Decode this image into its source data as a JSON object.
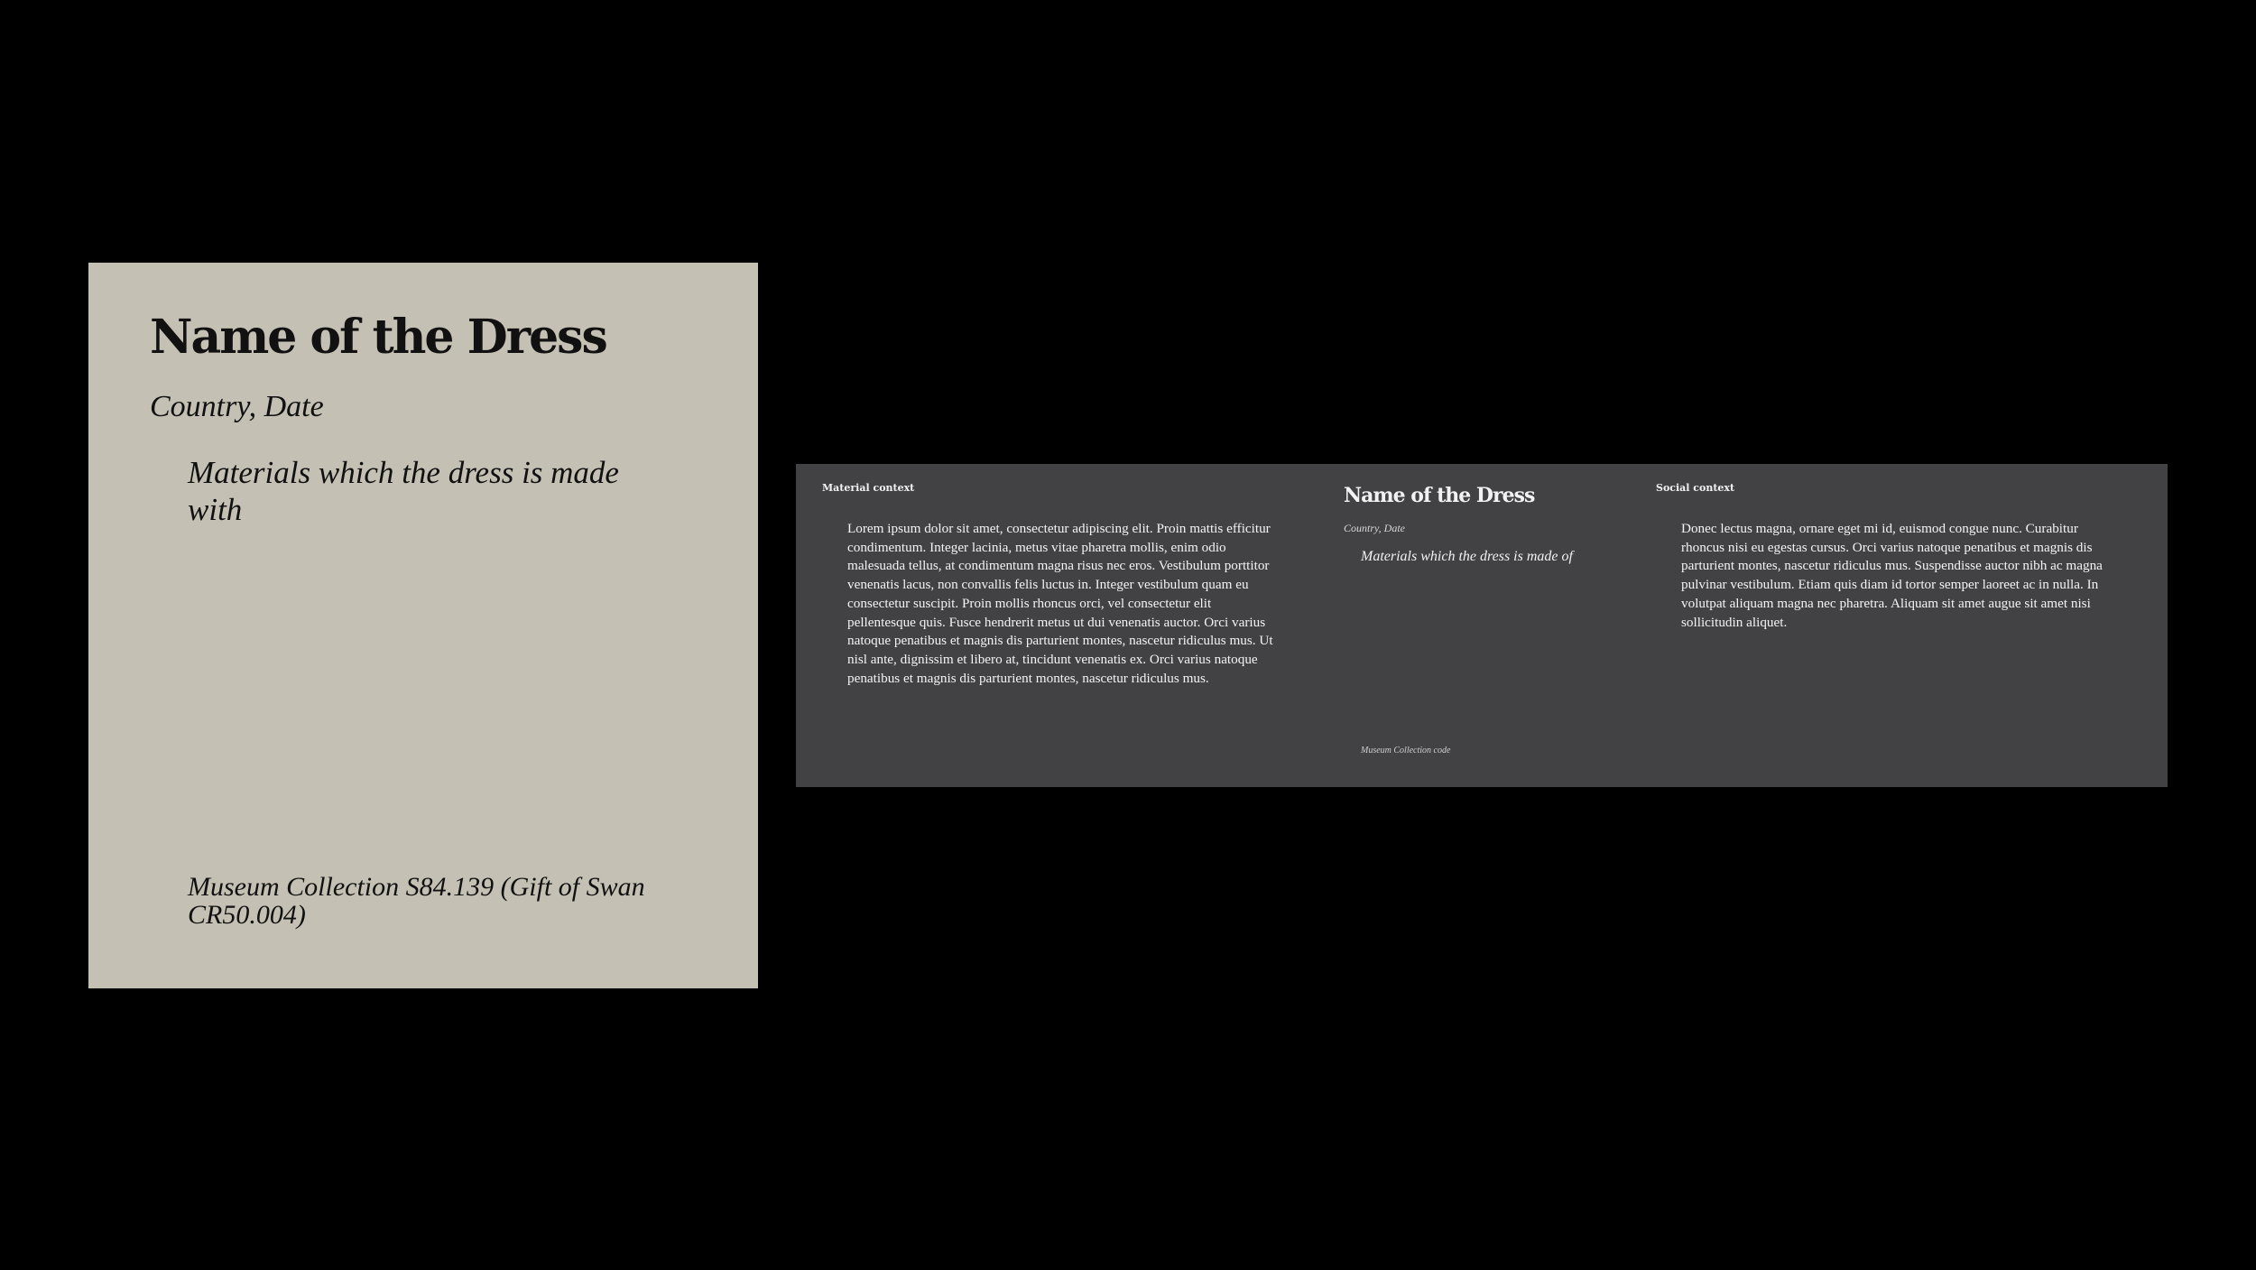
{
  "card": {
    "background": "#c4c0b4",
    "title": "Name of the Dress",
    "subtitle": "Country, Date",
    "materials": "Materials which the dress is made with",
    "collection": "Museum Collection S84.139 (Gift of Swan CR50.004)"
  },
  "panel": {
    "background": "#424245",
    "material_heading": "Material context",
    "material_text": "Lorem ipsum dolor sit amet, consectetur adipiscing elit. Proin mattis efficitur condimentum. Integer lacinia, metus vitae pharetra mollis, enim odio malesuada tellus, at condimentum magna risus nec eros. Vestibulum porttitor venenatis lacus, non convallis felis luctus in. Integer vestibulum quam eu consectetur suscipit. Proin mollis rhoncus orci, vel consectetur elit pellentesque quis. Fusce hendrerit metus ut dui venenatis auctor. Orci varius natoque penatibus et magnis dis parturient montes, nascetur ridiculus mus. Ut nisl ante, dignissim et libero at, tincidunt venenatis ex. Orci varius natoque penatibus et magnis dis parturient montes, nascetur ridiculus mus.",
    "center_title": "Name of the Dress",
    "center_subtitle": "Country, Date",
    "center_materials": "Materials which the dress is made of",
    "center_code": "Museum Collection code",
    "social_heading": "Social context",
    "social_text": "Donec lectus magna, ornare eget mi id, euismod congue nunc. Curabitur rhoncus nisi eu egestas cursus. Orci varius natoque penatibus et magnis dis parturient montes, nascetur ridiculus mus. Suspendisse auctor nibh ac magna pulvinar vestibulum. Etiam quis diam id tortor semper laoreet ac in nulla. In volutpat aliquam magna nec pharetra. Aliquam sit amet augue sit amet nisi sollicitudin aliquet."
  }
}
